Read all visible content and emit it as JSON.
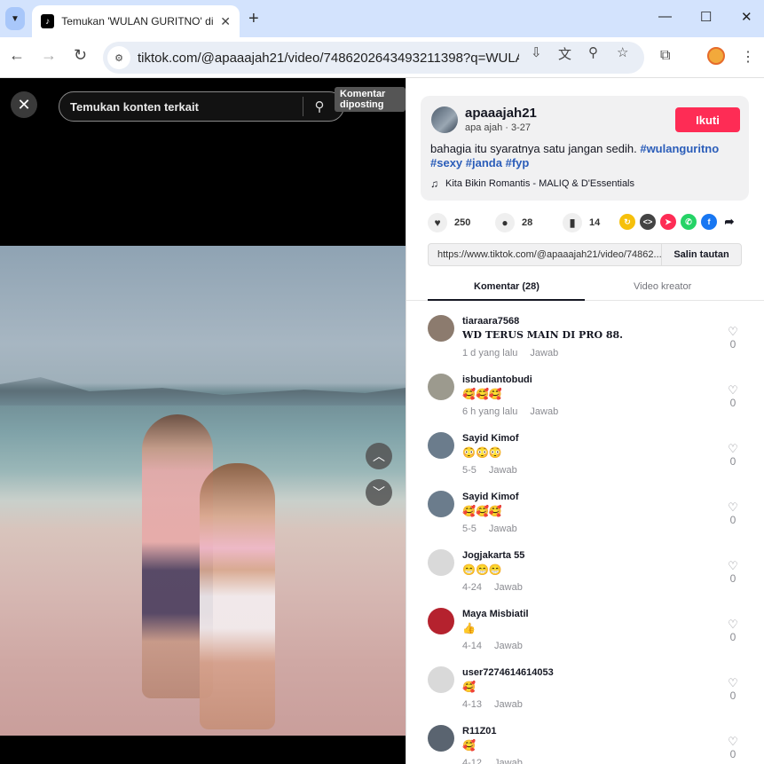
{
  "browser": {
    "tab_title": "Temukan 'WULAN GURITNO' di",
    "url": "tiktok.com/@apaaajah21/video/7486202643493211398?q=WULAN...",
    "tab_search_icon": "chevron-down-icon",
    "new_tab_icon": "plus-icon"
  },
  "video": {
    "search_placeholder": "Temukan konten terkait",
    "tooltip": "Komentar diposting"
  },
  "author": {
    "name": "apaaajah21",
    "subtitle": "apa ajah · 3-27",
    "follow_label": "Ikuti",
    "description_text": "bahagia itu syaratnya satu jangan sedih.",
    "tags": [
      "#wulanguritno",
      "#sexy",
      "#janda",
      "#fyp"
    ],
    "music": "Kita Bikin Romantis - MALIQ & D'Essentials"
  },
  "stats": {
    "likes": "250",
    "comments": "28",
    "saves": "14"
  },
  "share": {
    "link": "https://www.tiktok.com/@apaaajah21/video/74862...",
    "copy_label": "Salin tautan"
  },
  "tabs": {
    "comments": "Komentar (28)",
    "creator_videos": "Video kreator"
  },
  "reply_label": "Jawab",
  "comments": [
    {
      "name": "tiaraara7568",
      "text": "WD TERUS MAIN DI PRO 88.",
      "time": "1 d yang lalu",
      "likes": "0",
      "avatar_color": "#8c7b6e"
    },
    {
      "name": "isbudiantobudi",
      "text": "🥰🥰🥰",
      "time": "6 h yang lalu",
      "likes": "0",
      "avatar_color": "#9c9a8e"
    },
    {
      "name": "Sayid Kimof",
      "text": "😳😳😳",
      "time": "5-5",
      "likes": "0",
      "avatar_color": "#6b7c8c"
    },
    {
      "name": "Sayid Kimof",
      "text": "🥰🥰🥰",
      "time": "5-5",
      "likes": "0",
      "avatar_color": "#6b7c8c"
    },
    {
      "name": "Jogjakarta 55",
      "text": "😁😁😁",
      "time": "4-24",
      "likes": "0",
      "avatar_color": "#d9d9d9"
    },
    {
      "name": "Maya Misbiatil",
      "text": "👍",
      "time": "4-14",
      "likes": "0",
      "avatar_color": "#b5222e"
    },
    {
      "name": "user7274614614053",
      "text": "🥰",
      "time": "4-13",
      "likes": "0",
      "avatar_color": "#d9d9d9"
    },
    {
      "name": "R11Z01",
      "text": "🥰",
      "time": "4-12",
      "likes": "0",
      "avatar_color": "#5a6470"
    }
  ]
}
